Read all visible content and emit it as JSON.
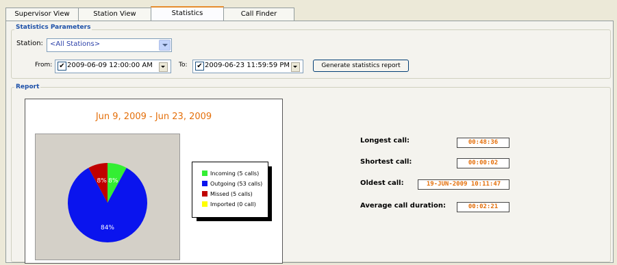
{
  "tabs": [
    "Supervisor View",
    "Station View",
    "Statistics",
    "Call Finder"
  ],
  "params": {
    "title": "Statistics Parameters",
    "station_label": "Station:",
    "station_value": "<All Stations>",
    "from_label": "From:",
    "from_value": "2009-06-09 12:00:00 AM",
    "to_label": "To:",
    "to_value": "2009-06-23 11:59:59 PM",
    "generate_button": "Generate statistics report"
  },
  "report": {
    "title": "Report",
    "longest_label": "Longest call:",
    "longest_value": "00:48:36",
    "shortest_label": "Shortest call:",
    "shortest_value": "00:00:02",
    "oldest_label": "Oldest call:",
    "oldest_value": "19-JUN-2009 10:11:47",
    "average_label": "Average call duration:",
    "average_value": "00:02:21"
  },
  "chart_data": {
    "type": "pie",
    "title": "Jun 9, 2009 - Jun 23, 2009",
    "slices": [
      {
        "name": "Incoming (5 calls)",
        "value": 5,
        "label": "8%",
        "color": "#33ee33"
      },
      {
        "name": "Outgoing (53 calls)",
        "value": 53,
        "label": "84%",
        "color": "#0a14ee"
      },
      {
        "name": "Missed (5 calls)",
        "value": 5,
        "label": "8%",
        "color": "#c00000"
      },
      {
        "name": "Imported (0 call)",
        "value": 0,
        "label": "",
        "color": "#ffff00"
      }
    ]
  }
}
